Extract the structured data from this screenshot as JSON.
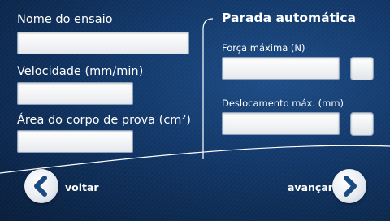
{
  "form": {
    "test_name_label": "Nome do ensaio",
    "test_name_value": "",
    "speed_label": "Velocidade (mm/min)",
    "speed_value": "",
    "area_label": "Área do corpo de prova (cm²)",
    "area_value": ""
  },
  "auto_stop": {
    "title": "Parada automática",
    "max_force_label": "Força máxima (N)",
    "max_force_value": "",
    "max_force_checked": false,
    "max_disp_label": "Deslocamento máx. (mm)",
    "max_disp_value": "",
    "max_disp_checked": false
  },
  "nav": {
    "back_label": "voltar",
    "back_icon": "chevron-left-icon",
    "next_label": "avançar",
    "next_icon": "chevron-right-icon"
  },
  "colors": {
    "background": "#133a6d",
    "icon": "#1e4a82"
  }
}
